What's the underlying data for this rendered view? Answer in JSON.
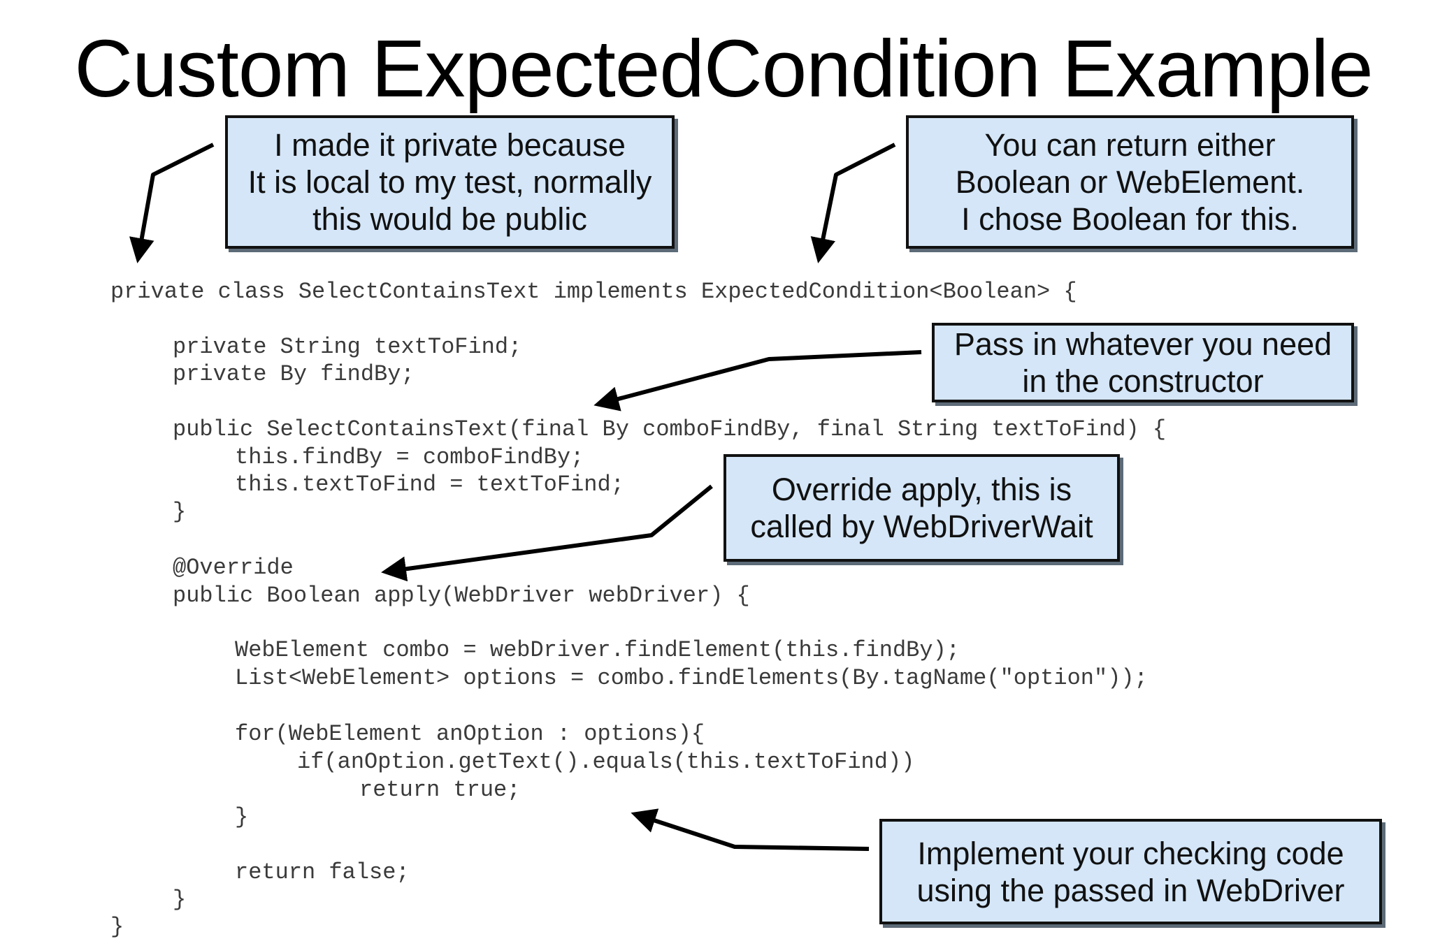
{
  "title": "Custom ExpectedCondition Example",
  "code": [
    "private class SelectContainsText implements ExpectedCondition<Boolean> {",
    "private String textToFind;",
    "private By findBy;",
    "public SelectContainsText(final By comboFindBy, final String textToFind) {",
    "this.findBy = comboFindBy;",
    "this.textToFind = textToFind;",
    "}",
    "@Override",
    "public Boolean apply(WebDriver webDriver) {",
    "WebElement combo = webDriver.findElement(this.findBy);",
    "List<WebElement> options = combo.findElements(By.tagName(\"option\"));",
    "for(WebElement anOption : options){",
    "if(anOption.getText().equals(this.textToFind))",
    "return true;",
    "}",
    "return false;",
    "}",
    "}"
  ],
  "callouts": {
    "private": [
      "I made it private because",
      "It is local to my test, normally",
      "this would be public"
    ],
    "return_type": [
      "You can return either",
      "Boolean or WebElement.",
      "I chose Boolean for this."
    ],
    "constructor": [
      "Pass in whatever you need",
      "in the constructor"
    ],
    "apply": [
      "Override apply, this is",
      "called by WebDriverWait"
    ],
    "checking": [
      "Implement your checking code",
      "using the passed in WebDriver"
    ]
  },
  "colors": {
    "callout_fill": "#d4e6f8",
    "callout_border": "#111111",
    "code_text": "#3a3a3a"
  }
}
